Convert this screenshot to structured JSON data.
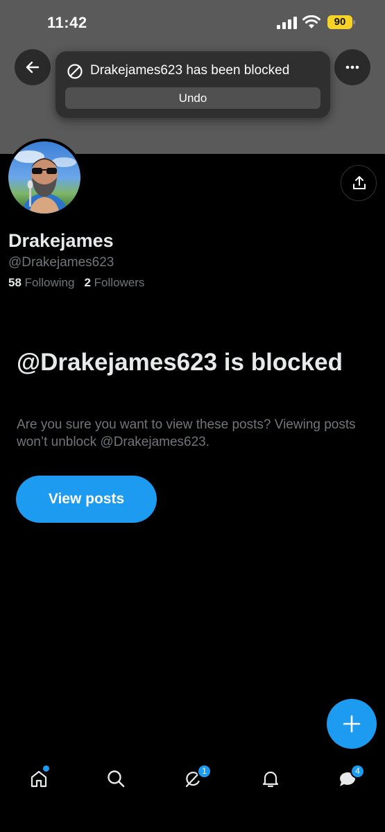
{
  "status_bar": {
    "time": "11:42",
    "battery_level": "90",
    "icons": [
      "signal-icon",
      "wifi-icon",
      "battery-icon"
    ]
  },
  "toast": {
    "icon": "block-icon",
    "message": "Drakejames623 has been blocked",
    "undo_label": "Undo"
  },
  "header": {
    "back_icon": "arrow-left-icon",
    "more_icon": "more-horizontal-icon"
  },
  "profile": {
    "display_name": "Drakejames",
    "handle": "@Drakejames623",
    "following_count": "58",
    "following_label": "Following",
    "followers_count": "2",
    "followers_label": "Followers",
    "share_icon": "share-icon"
  },
  "blocked": {
    "title": "@Drakejames623 is blocked",
    "description": "Are you sure you want to view these posts? Viewing posts won’t unblock @Drakejames623.",
    "view_posts_label": "View posts"
  },
  "fab": {
    "icon": "plus-icon"
  },
  "bottom_nav": {
    "items": [
      {
        "name": "home",
        "icon": "home-icon",
        "badge": "dot"
      },
      {
        "name": "search",
        "icon": "search-icon"
      },
      {
        "name": "grok",
        "icon": "grok-icon",
        "badge": "1"
      },
      {
        "name": "notifications",
        "icon": "bell-icon"
      },
      {
        "name": "messages",
        "icon": "messages-icon",
        "badge": "4"
      }
    ]
  },
  "colors": {
    "accent": "#1d9bf0",
    "background": "#000000",
    "banner": "#5a5a5a",
    "secondary_text": "#71767b",
    "battery": "#f7d327"
  }
}
